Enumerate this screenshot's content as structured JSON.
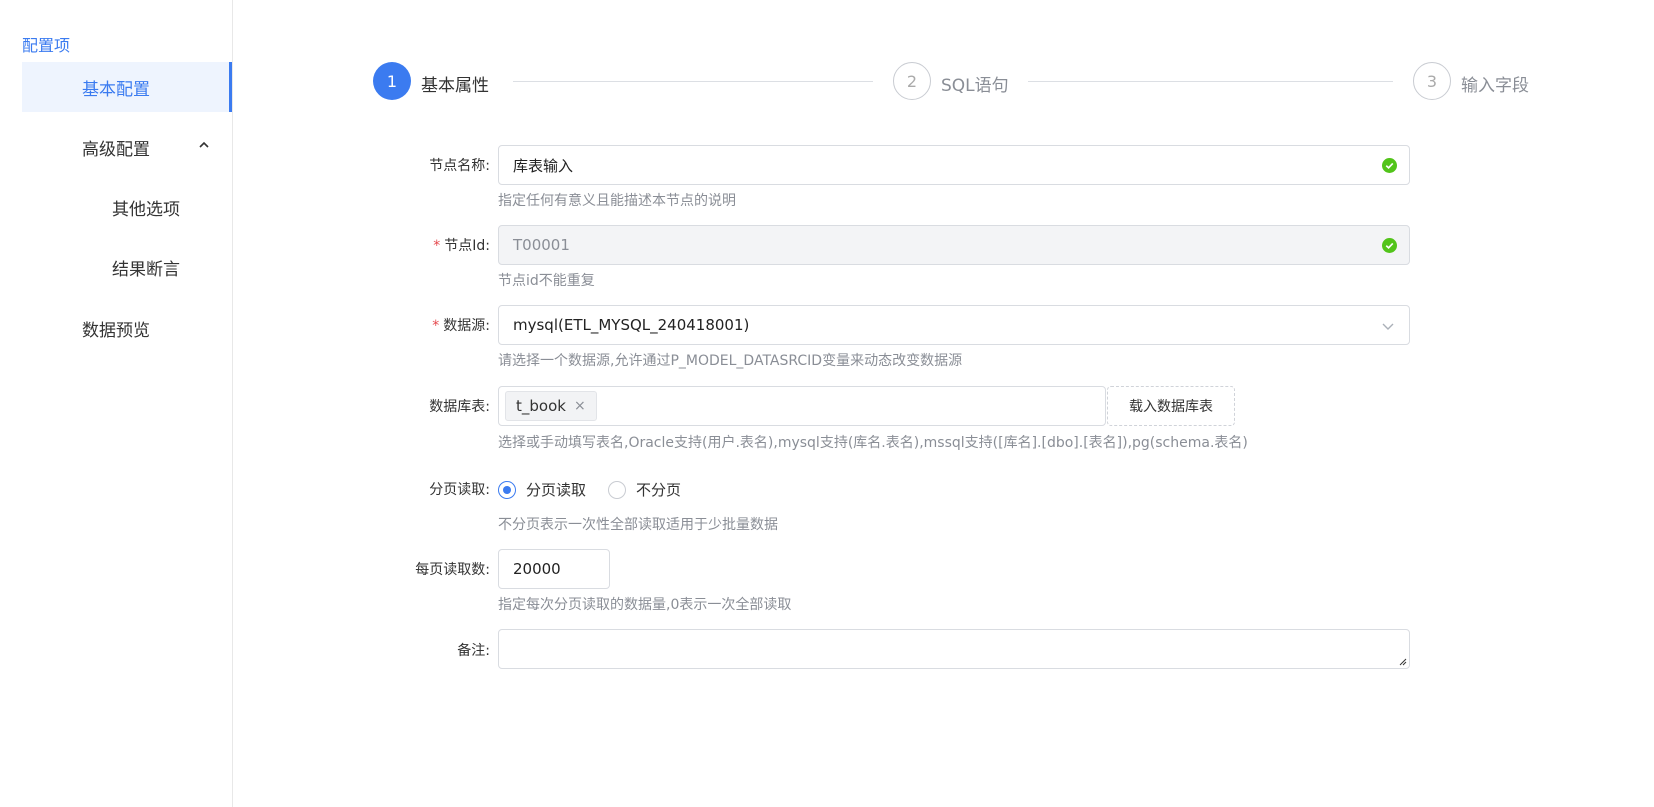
{
  "sidebar": {
    "title": "配置项",
    "items": [
      {
        "label": "基本配置"
      },
      {
        "label": "高级配置"
      },
      {
        "label": "其他选项"
      },
      {
        "label": "结果断言"
      },
      {
        "label": "数据预览"
      }
    ]
  },
  "steps": [
    {
      "number": "1",
      "label": "基本属性",
      "state": "active"
    },
    {
      "number": "2",
      "label": "SQL语句",
      "state": "idle"
    },
    {
      "number": "3",
      "label": "输入字段",
      "state": "idle"
    }
  ],
  "form": {
    "node_name": {
      "label": "节点名称:",
      "value": "库表输入",
      "hint": "指定任何有意义且能描述本节点的说明"
    },
    "node_id": {
      "required_mark": "*",
      "label": "节点Id:",
      "value": "T00001",
      "hint": "节点id不能重复"
    },
    "datasource": {
      "required_mark": "*",
      "label": "数据源:",
      "value": "mysql(ETL_MYSQL_240418001)",
      "hint": "请选择一个数据源,允许通过P_MODEL_DATASRCID变量来动态改变数据源"
    },
    "db_table": {
      "label": "数据库表:",
      "tag": "t_book",
      "tag_close": "×",
      "button": "载入数据库表",
      "hint": "选择或手动填写表名,Oracle支持(用户.表名),mysql支持(库名.表名),mssql支持([库名].[dbo].[表名]),pg(schema.表名)"
    },
    "paging": {
      "label": "分页读取:",
      "options": [
        "分页读取",
        "不分页"
      ],
      "selected": "分页读取",
      "hint": "不分页表示一次性全部读取适用于少批量数据"
    },
    "page_size": {
      "label": "每页读取数:",
      "value": "20000",
      "hint": "指定每次分页读取的数据量,0表示一次全部读取"
    },
    "remark": {
      "label": "备注:",
      "value": ""
    }
  },
  "colors": {
    "accent": "#3b7bf0",
    "success": "#52c41a",
    "required": "#e5484d"
  }
}
